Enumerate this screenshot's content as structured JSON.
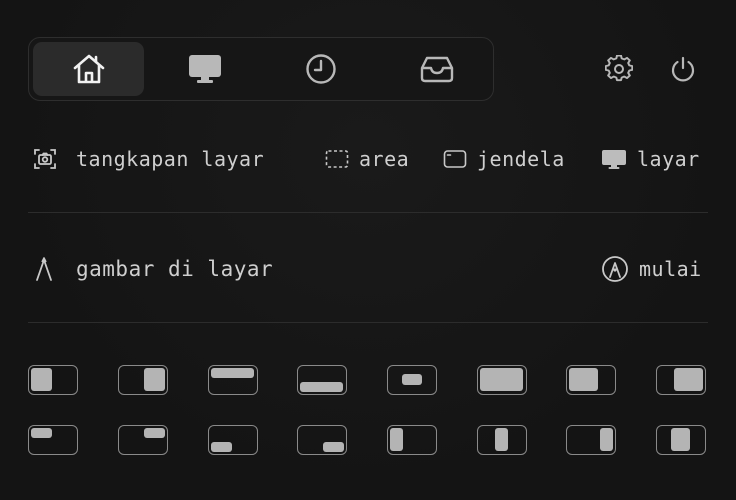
{
  "tabs": [
    {
      "name": "home",
      "icon": "home-icon",
      "active": true
    },
    {
      "name": "display",
      "icon": "monitor-icon",
      "active": false
    },
    {
      "name": "history",
      "icon": "clock-icon",
      "active": false
    },
    {
      "name": "inbox",
      "icon": "inbox-tray-icon",
      "active": false
    }
  ],
  "top_actions": {
    "settings_icon": "gear-icon",
    "power_icon": "power-icon"
  },
  "screenshot": {
    "label": "tangkapan layar",
    "options": [
      {
        "id": "area",
        "label": "area",
        "icon": "dashed-rect-icon"
      },
      {
        "id": "window",
        "label": "jendela",
        "icon": "window-icon"
      },
      {
        "id": "screen",
        "label": "layar",
        "icon": "monitor-icon"
      }
    ]
  },
  "draw": {
    "label": "gambar di layar",
    "start_label": "mulai"
  },
  "colors": {
    "background": "#151515",
    "text": "#cfcfcf",
    "icon": "#c8c8c8",
    "fill": "#b4b4b4",
    "border": "#8a8a8a"
  }
}
